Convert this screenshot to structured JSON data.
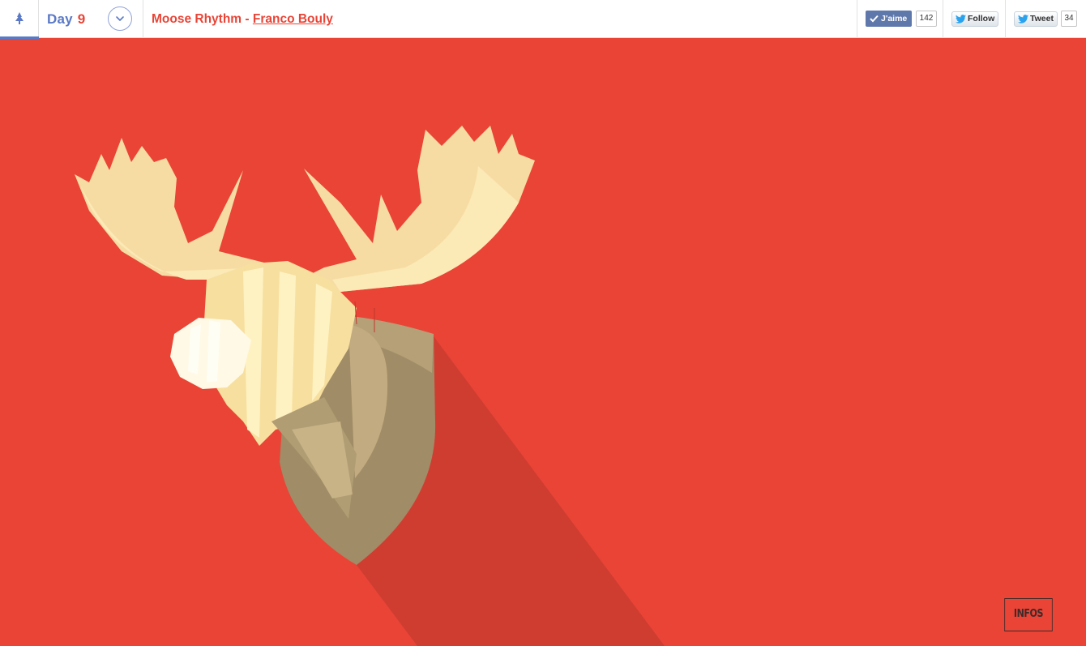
{
  "header": {
    "day_label": "Day",
    "day_number": "9",
    "title_prefix": "Moose Rhythm -",
    "author": "Franco Bouly"
  },
  "social": {
    "facebook": {
      "label": "J'aime",
      "count": "142"
    },
    "twitter_follow": {
      "label": "Follow"
    },
    "twitter_tweet": {
      "label": "Tweet",
      "count": "34"
    }
  },
  "main": {
    "infos_label": "INFOS"
  },
  "colors": {
    "background": "#e94436",
    "accent_blue": "#5a79c6",
    "shadow": "#cf3d31",
    "antler_light": "#f8dfa6",
    "shield": "#a08c66"
  },
  "icons": [
    "tree-icon",
    "chevron-down-icon",
    "facebook-check-icon",
    "twitter-bird-icon"
  ]
}
